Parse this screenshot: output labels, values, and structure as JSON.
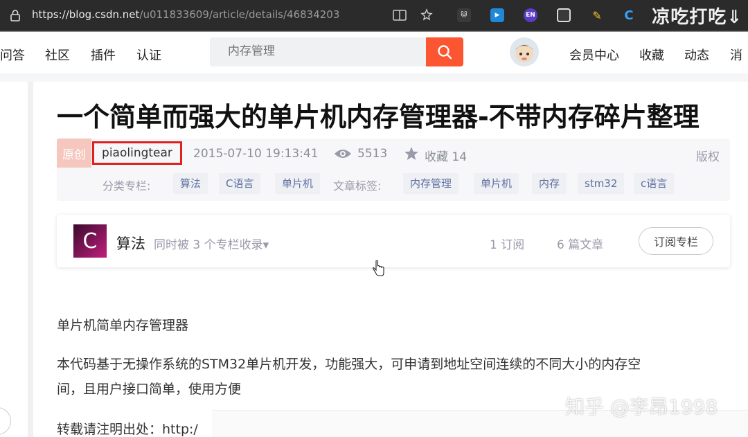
{
  "browser": {
    "url_main": "https://blog.csdn.net",
    "url_path": "/u011833609/article/details/46834203",
    "watermark_top": "凉吃打吃⇓"
  },
  "nav": {
    "items": [
      "问答",
      "社区",
      "插件",
      "认证"
    ],
    "search_placeholder": "内存管理",
    "right_items": [
      "会员中心",
      "收藏",
      "动态",
      "消"
    ]
  },
  "article": {
    "title": "一个简单而强大的单片机内存管理器-不带内存碎片整理",
    "badge": "原创",
    "author": "piaolingtear",
    "datetime": "2015-07-10 19:13:41",
    "views": "5513",
    "favorites": "收藏 14",
    "copyright": "版权",
    "category_label": "分类专栏:",
    "categories": [
      "算法",
      "C语言",
      "单片机"
    ],
    "tag_label": "文章标签:",
    "tags": [
      "内存管理",
      "单片机",
      "内存",
      "stm32",
      "c语言"
    ]
  },
  "column": {
    "logo_letter": "C",
    "name": "算法",
    "subtitle": "同时被 3 个专栏收录▾",
    "subscribers": "1 订阅",
    "articles": "6 篇文章",
    "subscribe_button": "订阅专栏"
  },
  "body": {
    "heading": "单片机简单内存管理器",
    "para1_line1": "本代码基于无操作系统的STM32单片机开发，功能强大，可申请到地址空间连续的不同大小的内存空",
    "para1_line2": "间，且用户接口简单，使用方便",
    "para2": "转载请注明出处：http:/"
  },
  "watermark_bottom": "知乎 @李昂1998",
  "colors": {
    "accent": "#fc5531",
    "author_box": "#e02020",
    "tag_text": "#5f6fa0",
    "browser_bar": "#2b2b2b"
  },
  "icons": [
    "lock-icon",
    "reader-mode-icon",
    "favorite-add-icon",
    "extension-icons",
    "search-icon",
    "eye-icon",
    "star-icon",
    "mouse-cursor-icon"
  ]
}
